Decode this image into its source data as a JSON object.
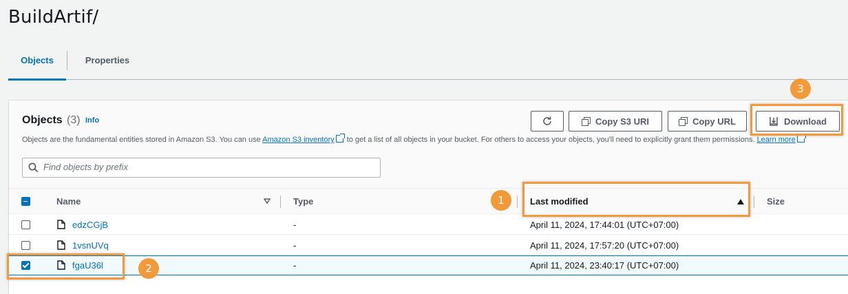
{
  "title": "BuildArtif/",
  "tabs": {
    "objects": "Objects",
    "properties": "Properties"
  },
  "objects_panel": {
    "heading": "Objects",
    "count": "(3)",
    "info": "Info",
    "desc_before": "Objects are the fundamental entities stored in Amazon S3. You can use ",
    "desc_link": "Amazon S3 inventory",
    "desc_after": " to get a list of all objects in your bucket. For others to access your objects, you'll need to explicitly grant them permissions. ",
    "learn_more": "Learn more"
  },
  "toolbar": {
    "copy_s3_uri": "Copy S3 URI",
    "copy_url": "Copy URL",
    "download": "Download"
  },
  "search": {
    "placeholder": "Find objects by prefix"
  },
  "table": {
    "headers": {
      "name": "Name",
      "type": "Type",
      "last_modified": "Last modified",
      "size": "Size"
    },
    "rows": [
      {
        "name": "edzCGjB",
        "type": "-",
        "last_modified": "April 11, 2024, 17:44:01 (UTC+07:00)",
        "checked": false
      },
      {
        "name": "1vsnUVq",
        "type": "-",
        "last_modified": "April 11, 2024, 17:57:20 (UTC+07:00)",
        "checked": false
      },
      {
        "name": "fgaU36l",
        "type": "-",
        "last_modified": "April 11, 2024, 23:40:17 (UTC+07:00)",
        "checked": true
      }
    ]
  },
  "annotations": {
    "badge1": "1",
    "badge2": "2",
    "badge3": "3"
  },
  "colors": {
    "accent": "#0073bb",
    "highlight": "#f29a3a"
  }
}
